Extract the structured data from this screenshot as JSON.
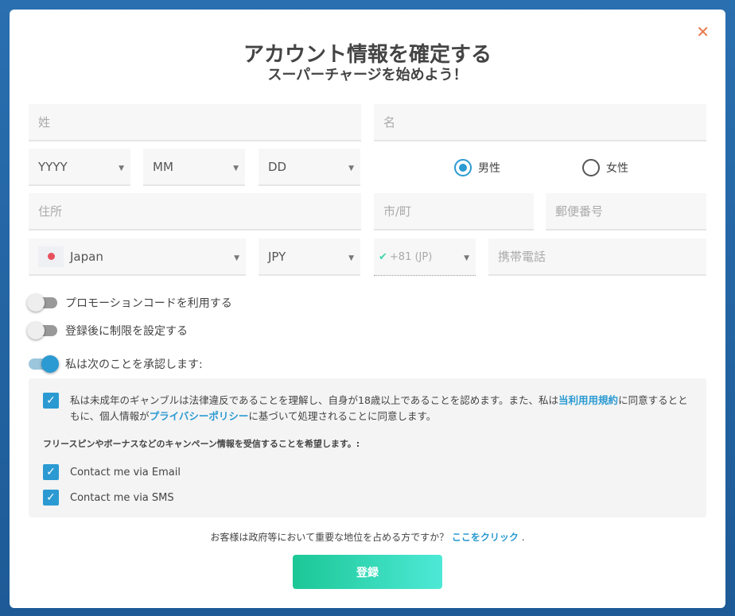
{
  "title": "アカウント情報を確定する",
  "subtitle": "スーパーチャージを始めよう！",
  "close": "✕",
  "fields": {
    "last_name": "姓",
    "first_name": "名",
    "year": "YYYY",
    "month": "MM",
    "day": "DD",
    "address": "住所",
    "city": "市/町",
    "postal": "郵便番号",
    "country": "Japan",
    "currency": "JPY",
    "phone_code": "+81 (JP)",
    "mobile": "携帯電話"
  },
  "gender": {
    "male": "男性",
    "female": "女性",
    "selected": "male"
  },
  "toggles": [
    {
      "label": "プロモーションコードを利用する",
      "on": false
    },
    {
      "label": "登録後に制限を設定する",
      "on": false
    },
    {
      "label": "私は次のことを承認します:",
      "on": true
    }
  ],
  "consent": {
    "text1": "私は未成年のギャンブルは法律違反であることを理解し、自身が18歳以上であることを認めます。また、私は",
    "terms": "当利用用規約",
    "text2": "に同意するとともに、個人情報が",
    "privacy": "プライバシーポリシー",
    "text3": "に基づいて処理されることに同意します。"
  },
  "campaign_label": "フリースピンやボーナスなどのキャンペーン情報を受信することを希望します。:",
  "contact_email": "Contact me via Email",
  "contact_sms": "Contact me via SMS",
  "pep": {
    "question": "お客様は政府等において重要な地位を占める方ですか？",
    "link": "ここをクリック",
    "end": "."
  },
  "submit": "登録",
  "colors": {
    "accent": "#2b9ad2",
    "button_start": "#1cc796",
    "button_end": "#4de9d6",
    "close": "#e87a4a"
  }
}
